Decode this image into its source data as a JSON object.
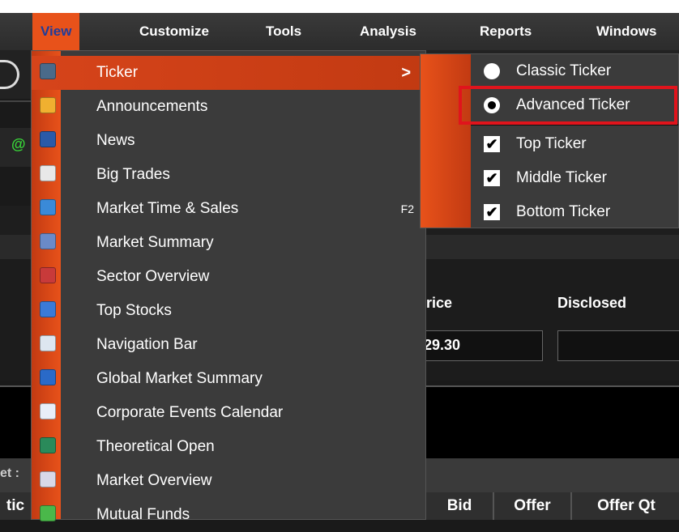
{
  "menubar": {
    "items": [
      "View",
      "Customize",
      "Tools",
      "Analysis",
      "Reports",
      "Windows"
    ]
  },
  "background": {
    "price_label": "rice",
    "disclosed_label": "Disclosed",
    "price_value": "29.30",
    "market_label": "et :",
    "columns": [
      "tic",
      "Bid",
      "Offer",
      "Offer Qt"
    ]
  },
  "view_menu": {
    "items": [
      {
        "label": "Ticker",
        "shortcut": "",
        "submenu_arrow": ">"
      },
      {
        "label": "Announcements",
        "shortcut": ""
      },
      {
        "label": "News",
        "shortcut": ""
      },
      {
        "label": "Big Trades",
        "shortcut": ""
      },
      {
        "label": "Market Time & Sales",
        "shortcut": "F2"
      },
      {
        "label": "Market Summary",
        "shortcut": ""
      },
      {
        "label": "Sector Overview",
        "shortcut": ""
      },
      {
        "label": "Top Stocks",
        "shortcut": ""
      },
      {
        "label": "Navigation Bar",
        "shortcut": ""
      },
      {
        "label": "Global Market Summary",
        "shortcut": ""
      },
      {
        "label": "Corporate Events Calendar",
        "shortcut": ""
      },
      {
        "label": "Theoretical Open",
        "shortcut": ""
      },
      {
        "label": "Market Overview",
        "shortcut": ""
      },
      {
        "label": "Mutual Funds",
        "shortcut": ""
      }
    ]
  },
  "ticker_submenu": {
    "radios": [
      {
        "label": "Classic Ticker",
        "selected": false
      },
      {
        "label": "Advanced Ticker",
        "selected": true
      }
    ],
    "checks": [
      {
        "label": "Top Ticker",
        "checked": true
      },
      {
        "label": "Middle Ticker",
        "checked": true
      },
      {
        "label": "Bottom Ticker",
        "checked": true
      }
    ],
    "check_glyph": "✔"
  },
  "colors": {
    "accent": "#e8521a",
    "highlight_box": "#e0141c",
    "menu_bg": "#3b3b3b"
  }
}
